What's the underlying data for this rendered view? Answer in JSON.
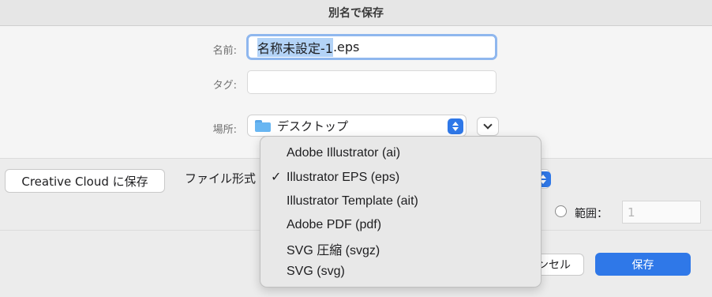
{
  "window": {
    "title": "別名で保存"
  },
  "name_field": {
    "label": "名前:",
    "value_selected": "名称未設定-1",
    "value_rest": ".eps"
  },
  "tags_field": {
    "label": "タグ:",
    "value": ""
  },
  "location": {
    "label": "場所:",
    "value": "デスクトップ"
  },
  "creative_cloud_button": "Creative Cloud に保存",
  "format_label": "ファイル形式",
  "range": {
    "label": "範囲：",
    "value": "1"
  },
  "buttons": {
    "cancel_visible": "ンセル",
    "save": "保存"
  },
  "format_menu": {
    "selected_index": 1,
    "check_glyph": "✓",
    "items": [
      {
        "label": "Adobe Illustrator (ai)"
      },
      {
        "label": "Illustrator EPS (eps)"
      },
      {
        "label": "Illustrator Template (ait)"
      },
      {
        "label": "Adobe PDF (pdf)"
      },
      {
        "label": "SVG 圧縮 (svgz)"
      },
      {
        "label": "SVG (svg)"
      }
    ]
  },
  "colors": {
    "accent": "#2f78e8",
    "selection": "#b3d3f7",
    "focus_ring": "#8fb7ee"
  },
  "icons": {
    "location": "folder-icon",
    "expand": "chevron-down-icon",
    "stepper": "up-down-stepper-icon"
  }
}
